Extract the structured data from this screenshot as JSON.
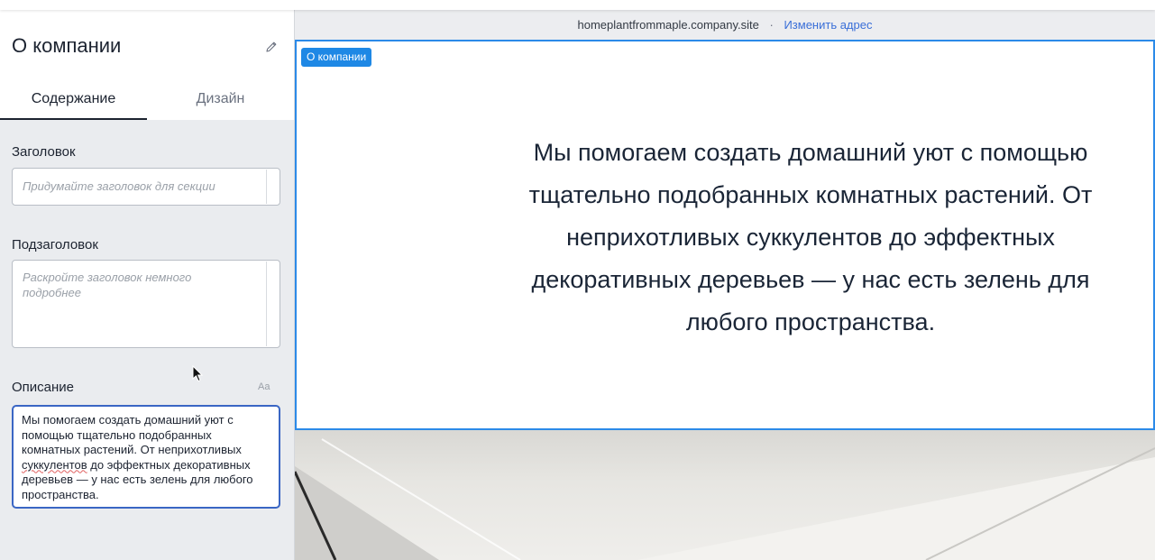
{
  "sidebar": {
    "title": "О компании",
    "tabs": [
      {
        "label": "Содержание",
        "active": true
      },
      {
        "label": "Дизайн",
        "active": false
      }
    ],
    "fields": {
      "heading": {
        "label": "Заголовок",
        "placeholder": "Придумайте заголовок для секции"
      },
      "subheading": {
        "label": "Подзаголовок",
        "placeholder": "Раскройте заголовок немного подробнее"
      },
      "description": {
        "label": "Описание",
        "format_label": "Aa",
        "value_before": "Мы помогаем создать домашний уют с помощью тщательно подобранных комнатных растений. От неприхотливых ",
        "value_spell": "суккулентов",
        "value_after": " до эффектных декоративных деревьев — у нас есть зелень для любого пространства."
      }
    }
  },
  "preview": {
    "url": "homeplantfrommaple.company.site",
    "separator": "·",
    "change_address": "Изменить адрес",
    "section_badge": "О компании",
    "section_text": "Мы помогаем создать домашний уют с помощью тщательно подобранных комнатных растений. От неприхотливых суккулентов до эффектных декоративных деревьев — у нас есть зелень для любого пространства."
  },
  "icons": {
    "edit": "pencil-icon",
    "cursor": "mouse-pointer-icon"
  },
  "colors": {
    "accent": "#1e88e5",
    "focus_border": "#3a66c4",
    "link": "#3a6fd8",
    "sidebar_bg": "#eaecef"
  }
}
